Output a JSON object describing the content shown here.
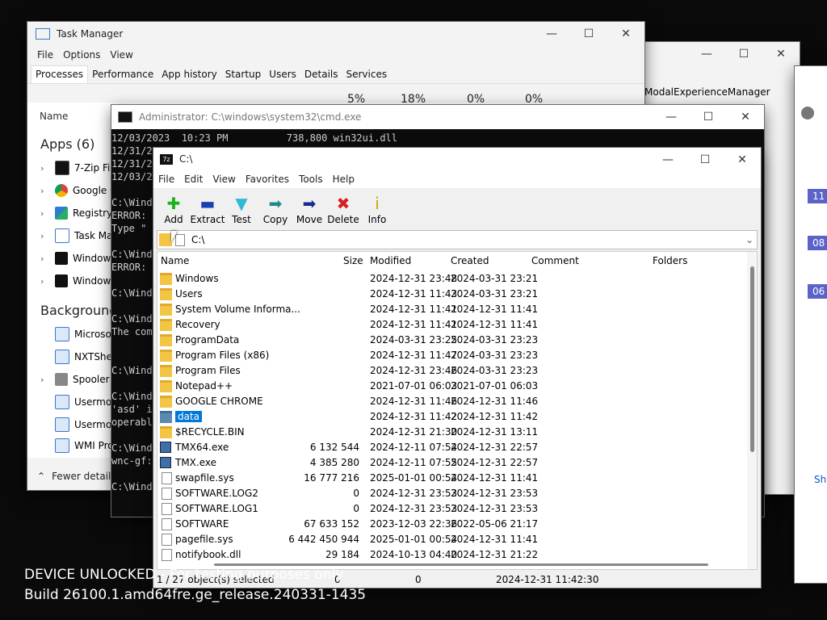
{
  "background_window": {
    "label": "ModalExperienceManager"
  },
  "right_window": {
    "items": [
      "11",
      "08",
      "06"
    ],
    "label": "Sh"
  },
  "task_manager": {
    "title": "Task Manager",
    "menu": [
      "File",
      "Options",
      "View"
    ],
    "tabs": [
      "Processes",
      "Performance",
      "App history",
      "Startup",
      "Users",
      "Details",
      "Services"
    ],
    "percent": [
      "5%",
      "18%",
      "0%",
      "0%"
    ],
    "name_header": "Name",
    "apps_header": "Apps (6)",
    "apps": [
      "7-Zip File",
      "Google C",
      "Registry",
      "Task Mar",
      "Window",
      "Window"
    ],
    "background_header": "Background",
    "background": [
      "Microsof",
      "NXTShel",
      "Spooler S",
      "Usermod",
      "Usermod",
      "WMI Pro"
    ],
    "fewer_details": "Fewer details"
  },
  "cmd": {
    "title": "Administrator: C:\\windows\\system32\\cmd.exe",
    "lines": [
      "12/03/2023  10:23 PM          738,800 win32ui.dll",
      "12/31/2",
      "12/31/2",
      "12/03/2",
      "",
      "C:\\Wind",
      "ERROR:",
      "Type \"",
      "",
      "C:\\Wind",
      "ERROR:",
      "",
      "C:\\Wind",
      "",
      "C:\\Wind",
      "The com",
      "",
      "",
      "C:\\Wind",
      "",
      "C:\\Wind",
      "'asd' i",
      "operabl",
      "",
      "C:\\Wind",
      "wnc-gf:",
      "",
      "C:\\Wind"
    ]
  },
  "zip": {
    "title": "C:\\",
    "menu": [
      "File",
      "Edit",
      "View",
      "Favorites",
      "Tools",
      "Help"
    ],
    "toolbar": [
      {
        "label": "Add",
        "glyph": "✚",
        "color": "#1db31d"
      },
      {
        "label": "Extract",
        "glyph": "▬",
        "color": "#1a3fb0"
      },
      {
        "label": "Test",
        "glyph": "▼",
        "color": "#2fb8d8"
      },
      {
        "label": "Copy",
        "glyph": "➡",
        "color": "#1e8a8a"
      },
      {
        "label": "Move",
        "glyph": "➡",
        "color": "#1a2a90"
      },
      {
        "label": "Delete",
        "glyph": "✖",
        "color": "#d81e1e"
      },
      {
        "label": "Info",
        "glyph": "i",
        "color": "#c8a800"
      }
    ],
    "address": "C:\\",
    "columns": [
      "Name",
      "Size",
      "Modified",
      "Created",
      "Comment",
      "Folders"
    ],
    "files": [
      {
        "name": "Windows",
        "size": "",
        "modified": "2024-12-31 23:48",
        "created": "2024-03-31 23:21",
        "type": "folder"
      },
      {
        "name": "Users",
        "size": "",
        "modified": "2024-12-31 11:43",
        "created": "2024-03-31 23:21",
        "type": "folder"
      },
      {
        "name": "System Volume Informa...",
        "size": "",
        "modified": "2024-12-31 11:41",
        "created": "2024-12-31 11:41",
        "type": "folder"
      },
      {
        "name": "Recovery",
        "size": "",
        "modified": "2024-12-31 11:41",
        "created": "2024-12-31 11:41",
        "type": "folder"
      },
      {
        "name": "ProgramData",
        "size": "",
        "modified": "2024-03-31 23:25",
        "created": "2024-03-31 23:23",
        "type": "folder"
      },
      {
        "name": "Program Files (x86)",
        "size": "",
        "modified": "2024-12-31 11:47",
        "created": "2024-03-31 23:23",
        "type": "folder"
      },
      {
        "name": "Program Files",
        "size": "",
        "modified": "2024-12-31 23:46",
        "created": "2024-03-31 23:23",
        "type": "folder"
      },
      {
        "name": "Notepad++",
        "size": "",
        "modified": "2021-07-01 06:03",
        "created": "2021-07-01 06:03",
        "type": "folder"
      },
      {
        "name": "GOOGLE CHROME",
        "size": "",
        "modified": "2024-12-31 11:46",
        "created": "2024-12-31 11:46",
        "type": "folder"
      },
      {
        "name": "data",
        "size": "",
        "modified": "2024-12-31 11:42",
        "created": "2024-12-31 11:42",
        "type": "folder",
        "selected": true
      },
      {
        "name": "$RECYCLE.BIN",
        "size": "",
        "modified": "2024-12-31 21:30",
        "created": "2024-12-31 13:11",
        "type": "folder"
      },
      {
        "name": "TMX64.exe",
        "size": "6 132 544",
        "modified": "2024-12-11 07:54",
        "created": "2024-12-31 22:57",
        "type": "exe"
      },
      {
        "name": "TMX.exe",
        "size": "4 385 280",
        "modified": "2024-12-11 07:55",
        "created": "2024-12-31 22:57",
        "type": "exe"
      },
      {
        "name": "swapfile.sys",
        "size": "16 777 216",
        "modified": "2025-01-01 00:54",
        "created": "2024-12-31 11:41",
        "type": "file"
      },
      {
        "name": "SOFTWARE.LOG2",
        "size": "0",
        "modified": "2024-12-31 23:53",
        "created": "2024-12-31 23:53",
        "type": "file"
      },
      {
        "name": "SOFTWARE.LOG1",
        "size": "0",
        "modified": "2024-12-31 23:53",
        "created": "2024-12-31 23:53",
        "type": "file"
      },
      {
        "name": "SOFTWARE",
        "size": "67 633 152",
        "modified": "2023-12-03 22:36",
        "created": "2022-05-06 21:17",
        "type": "file"
      },
      {
        "name": "pagefile.sys",
        "size": "6 442 450 944",
        "modified": "2025-01-01 00:54",
        "created": "2024-12-31 11:41",
        "type": "file"
      },
      {
        "name": "notifybook.dll",
        "size": "29 184",
        "modified": "2024-10-13 04:40",
        "created": "2024-12-31 21:22",
        "type": "file"
      }
    ],
    "status": {
      "selected": "1 / 27 object(s) selected",
      "size": "0",
      "packed": "0",
      "date": "2024-12-31 11:42:30"
    }
  },
  "watermark": {
    "line1": "DEVICE UNLOCKED - For testing purposes only",
    "line2": "Build 26100.1.amd64fre.ge_release.240331-1435"
  }
}
